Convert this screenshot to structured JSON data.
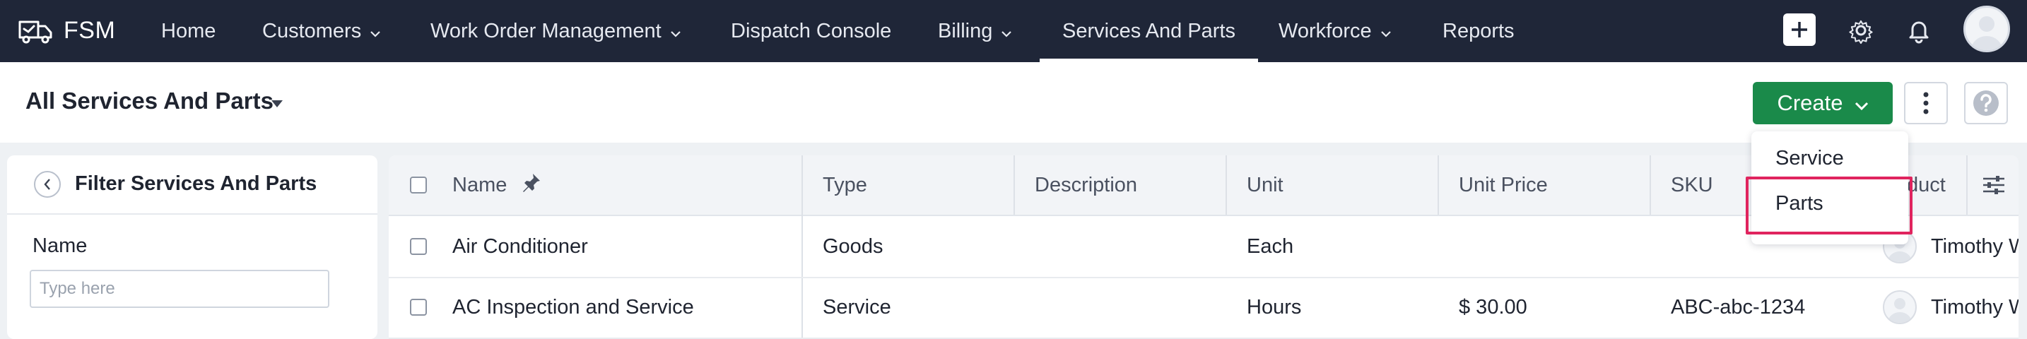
{
  "app": {
    "name": "FSM"
  },
  "nav": {
    "items": [
      {
        "label": "Home",
        "has_menu": false
      },
      {
        "label": "Customers",
        "has_menu": true
      },
      {
        "label": "Work Order Management",
        "has_menu": true
      },
      {
        "label": "Dispatch Console",
        "has_menu": false
      },
      {
        "label": "Billing",
        "has_menu": true
      },
      {
        "label": "Services And Parts",
        "has_menu": false,
        "active": true
      },
      {
        "label": "Workforce",
        "has_menu": true
      },
      {
        "label": "Reports",
        "has_menu": false
      }
    ],
    "icons": [
      "plus-icon",
      "gear-icon",
      "bell-icon",
      "user-avatar"
    ]
  },
  "header": {
    "title": "All Services And Parts",
    "create_label": "Create",
    "icons": [
      "caret-down-icon",
      "more-vertical-icon",
      "help-icon"
    ]
  },
  "create_menu": {
    "items": [
      {
        "label": "Service"
      },
      {
        "label": "Parts",
        "highlighted": true
      }
    ]
  },
  "filter": {
    "title": "Filter Services And Parts",
    "fields": [
      {
        "label": "Name",
        "placeholder": "Type here",
        "value": ""
      }
    ]
  },
  "table": {
    "columns": [
      "Name",
      "Type",
      "Description",
      "Unit",
      "Unit Price",
      "SKU",
      "duct"
    ],
    "rows": [
      {
        "name": "Air Conditioner",
        "type": "Goods",
        "description": "",
        "unit": "Each",
        "unit_price": "",
        "sku": "",
        "owner": "Timothy W"
      },
      {
        "name": "AC Inspection and Service",
        "type": "Service",
        "description": "",
        "unit": "Hours",
        "unit_price": "$ 30.00",
        "sku": "ABC-abc-1234",
        "owner": "Timothy W"
      }
    ]
  },
  "colors": {
    "nav_bg": "#1f2638",
    "create_green": "#1a8a4a",
    "highlight_red": "#e0245e",
    "page_bg": "#eef1f4"
  }
}
